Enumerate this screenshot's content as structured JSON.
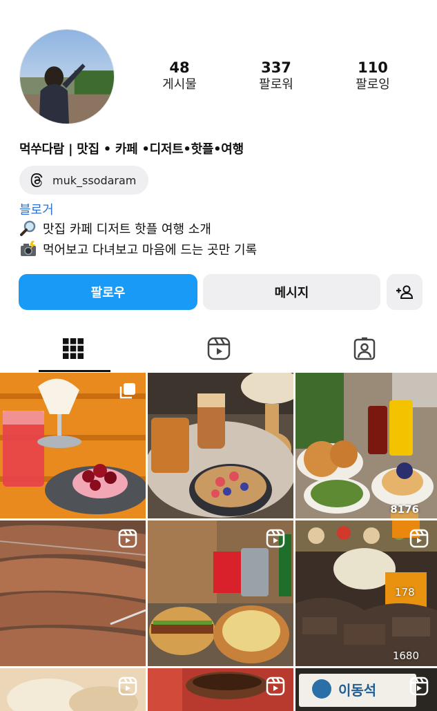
{
  "profile": {
    "stats": [
      {
        "value": "48",
        "label": "게시물"
      },
      {
        "value": "337",
        "label": "팔로워"
      },
      {
        "value": "110",
        "label": "팔로잉"
      }
    ],
    "name": "먹쑤다람 | 맛집 • 카페 •디저트•핫플•여행",
    "threads_handle": "muk_ssodaram",
    "category_link": "블로거",
    "bio": [
      {
        "icon": "magnifier-emoji",
        "text": "맛집 카페 디저트 핫플 여행 소개"
      },
      {
        "icon": "camera-flash-emoji",
        "text": "먹어보고 다녀보고 마음에 드는 곳만 기록"
      }
    ]
  },
  "actions": {
    "follow_label": "팔로우",
    "message_label": "메시지",
    "add_user_icon": "add-user-icon"
  },
  "tabs": [
    {
      "name": "grid",
      "icon": "grid-icon",
      "selected": true
    },
    {
      "name": "reels",
      "icon": "reels-icon",
      "selected": false
    },
    {
      "name": "tagged",
      "icon": "tagged-person-icon",
      "selected": false
    }
  ],
  "grid": {
    "tiles": [
      {
        "subject": "cherry cake and soft-serve cocktails",
        "badge": "multi-post-icon"
      },
      {
        "subject": "latte with waffle and berries",
        "badge": ""
      },
      {
        "subject": "bagels, salad and juice",
        "badge": "",
        "overlay_text": "8176"
      },
      {
        "subject": "grilled pork ribs",
        "badge": "reels-icon"
      },
      {
        "subject": "burger, fries and drinks",
        "badge": "reels-icon"
      },
      {
        "subject": "grilled meat platter",
        "badge": "reels-icon",
        "overlay_text": [
          "178",
          "1680"
        ]
      },
      {
        "subject": "wrapped food",
        "badge": "reels-icon"
      },
      {
        "subject": "chocolate drink",
        "badge": "reels-icon"
      },
      {
        "subject": "restaurant signboard",
        "badge": "reels-icon",
        "sign_text": "이동석"
      }
    ]
  },
  "colors": {
    "accent": "#1a9af7",
    "link": "#2a6fd6",
    "button_bg": "#efeff1"
  }
}
